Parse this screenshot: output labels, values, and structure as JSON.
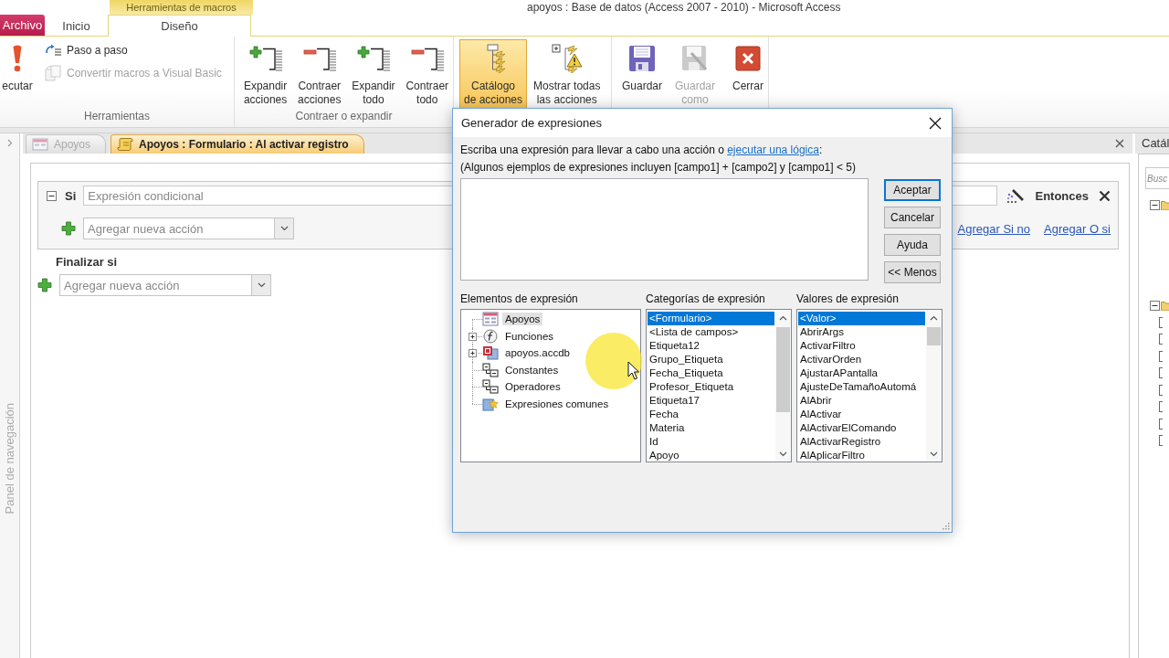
{
  "window": {
    "title": "apoyos : Base de datos (Access 2007 - 2010) - Microsoft Access"
  },
  "ribbon": {
    "context_label": "Herramientas de macros",
    "tabs": [
      {
        "label": "Archivo",
        "kind": "file",
        "selected": false
      },
      {
        "label": "Inicio",
        "kind": "standard",
        "selected": false
      },
      {
        "label": "Diseño",
        "kind": "contextual",
        "selected": true
      }
    ],
    "groups": [
      {
        "label": "Herramientas",
        "large_buttons": [
          {
            "label": "ecutar",
            "kind": "run",
            "disabled": false,
            "selected": false
          }
        ],
        "small_buttons": [
          {
            "label": "Paso a paso",
            "kind": "step",
            "disabled": false
          },
          {
            "label": "Convertir macros a Visual Basic",
            "kind": "convert",
            "disabled": true
          }
        ]
      },
      {
        "label": "Contraer o expandir",
        "large_buttons": [
          {
            "label": "Expandir\nacciones",
            "kind": "expand",
            "disabled": false,
            "selected": false
          },
          {
            "label": "Contraer\nacciones",
            "kind": "collapse",
            "disabled": false,
            "selected": false
          },
          {
            "label": "Expandir\ntodo",
            "kind": "expand",
            "disabled": false,
            "selected": false
          },
          {
            "label": "Contraer\ntodo",
            "kind": "collapse",
            "disabled": false,
            "selected": false
          }
        ]
      },
      {
        "large_buttons": [
          {
            "label": "Catálogo\nde acciones",
            "kind": "catalog",
            "disabled": false,
            "selected": true
          },
          {
            "label": "Mostrar todas\nlas acciones",
            "kind": "show_all",
            "disabled": false,
            "selected": false
          }
        ]
      },
      {
        "large_buttons": [
          {
            "label": "Guardar",
            "kind": "save",
            "disabled": false,
            "selected": false
          },
          {
            "label": "Guardar\ncomo",
            "kind": "save_as",
            "disabled": true,
            "selected": false
          },
          {
            "label": "Cerrar",
            "kind": "close",
            "disabled": false,
            "selected": false
          }
        ]
      }
    ]
  },
  "navigation_pane": {
    "label": "Panel de navegación"
  },
  "document_tabs": [
    {
      "label": "Apoyos",
      "kind": "form",
      "selected": false
    },
    {
      "label": "Apoyos : Formulario : Al activar registro",
      "kind": "macro",
      "selected": true
    }
  ],
  "macro": {
    "if_block": {
      "keyword": "Si",
      "expanded": true,
      "condition": {
        "placeholder": "Expresión condicional"
      },
      "then_label": "Entonces",
      "new_action": {
        "placeholder": "Agregar nueva acción"
      },
      "links": [
        "Agregar Si no",
        "Agregar O si"
      ]
    },
    "end_if": "Finalizar si",
    "new_action": {
      "placeholder": "Agregar nueva acción"
    }
  },
  "action_catalog": {
    "title": "Catál",
    "search": {
      "placeholder": "Busc"
    },
    "folders": [
      {
        "expanded": true
      },
      {
        "expanded": true,
        "items": [
          {
            "kind": "action"
          },
          {
            "kind": "action"
          },
          {
            "kind": "action"
          },
          {
            "kind": "action"
          },
          {
            "kind": "action"
          },
          {
            "kind": "action"
          },
          {
            "kind": "action"
          },
          {
            "kind": "action"
          }
        ]
      }
    ]
  },
  "expression_builder": {
    "title": "Generador de expresiones",
    "instruction": "Escriba una expresión para llevar a cabo una acción o ",
    "link": "ejecutar una lógica",
    "instruction_end": ":",
    "example": "(Algunos ejemplos de expresiones incluyen [campo1] + [campo2] y [campo1] < 5)",
    "buttons": [
      {
        "label": "Aceptar",
        "default": true
      },
      {
        "label": "Cancelar",
        "default": false
      },
      {
        "label": "Ayuda",
        "default": false
      },
      {
        "label": "<< Menos",
        "default": false
      }
    ],
    "elements": {
      "label": "Elementos de expresión",
      "items": [
        {
          "label": "Apoyos",
          "kind": "form",
          "expander": false,
          "selected": true
        },
        {
          "label": "Funciones",
          "kind": "functions",
          "expander": true,
          "selected": false
        },
        {
          "label": "apoyos.accdb",
          "kind": "database",
          "expander": true,
          "selected": false
        },
        {
          "label": "Constantes",
          "kind": "constants",
          "expander": false,
          "selected": false
        },
        {
          "label": "Operadores",
          "kind": "operators",
          "expander": false,
          "selected": false
        },
        {
          "label": "Expresiones comunes",
          "kind": "common",
          "expander": false,
          "selected": false
        }
      ]
    },
    "categories": {
      "label": "Categorías de expresión",
      "items": [
        {
          "label": "<Formulario>",
          "selected": true
        },
        {
          "label": "<Lista de campos>",
          "selected": false
        },
        {
          "label": "Etiqueta12",
          "selected": false
        },
        {
          "label": "Grupo_Etiqueta",
          "selected": false
        },
        {
          "label": "Fecha_Etiqueta",
          "selected": false
        },
        {
          "label": "Profesor_Etiqueta",
          "selected": false
        },
        {
          "label": "Etiqueta17",
          "selected": false
        },
        {
          "label": "Fecha",
          "selected": false
        },
        {
          "label": "Materia",
          "selected": false
        },
        {
          "label": "Id",
          "selected": false
        },
        {
          "label": "Apoyo",
          "selected": false
        }
      ]
    },
    "values": {
      "label": "Valores de expresión",
      "items": [
        {
          "label": "<Valor>",
          "selected": true
        },
        {
          "label": "AbrirArgs",
          "selected": false
        },
        {
          "label": "ActivarFiltro",
          "selected": false
        },
        {
          "label": "ActivarOrden",
          "selected": false
        },
        {
          "label": "AjustarAPantalla",
          "selected": false
        },
        {
          "label": "AjusteDeTamañoAutomá",
          "selected": false
        },
        {
          "label": "AlAbrir",
          "selected": false
        },
        {
          "label": "AlActivar",
          "selected": false
        },
        {
          "label": "AlActivarElComando",
          "selected": false
        },
        {
          "label": "AlActivarRegistro",
          "selected": false
        },
        {
          "label": "AlAplicarFiltro",
          "selected": false
        }
      ]
    }
  }
}
